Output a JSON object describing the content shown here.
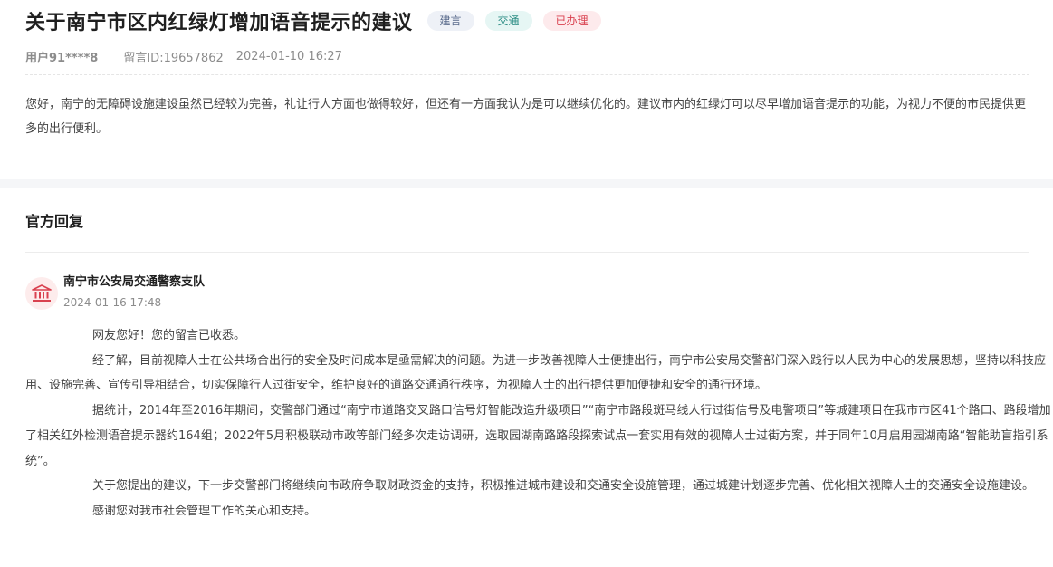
{
  "header": {
    "title": "关于南宁市区内红绿灯增加语音提示的建议",
    "tags": [
      {
        "label": "建言"
      },
      {
        "label": "交通"
      },
      {
        "label": "已办理"
      }
    ],
    "user": "用户91****8",
    "message_id": "留言ID:19657862",
    "time": "2024-01-10 16:27"
  },
  "message": {
    "text": "您好，南宁的无障碍设施建设虽然已经较为完善，礼让行人方面也做得较好，但还有一方面我认为是可以继续优化的。建议市内的红绿灯可以尽早增加语音提示的功能，为视力不便的市民提供更多的出行便利。"
  },
  "reply": {
    "heading": "官方回复",
    "org_icon": "government-building-icon",
    "org_name": "南宁市公安局交通警察支队",
    "time": "2024-01-16 17:48",
    "paragraphs": [
      "网友您好！您的留言已收悉。",
      "经了解，目前视障人士在公共场合出行的安全及时间成本是亟需解决的问题。为进一步改善视障人士便捷出行，南宁市公安局交警部门深入践行以人民为中心的发展思想，坚持以科技应用、设施完善、宣传引导相结合，切实保障行人过街安全，维护良好的道路交通通行秩序，为视障人士的出行提供更加便捷和安全的通行环境。",
      "据统计，2014年至2016年期间，交警部门通过“南宁市道路交叉路口信号灯智能改造升级项目”“南宁市路段斑马线人行过街信号及电警项目”等城建项目在我市市区41个路口、路段增加了相关红外检测语音提示器约164组；2022年5月积极联动市政等部门经多次走访调研，选取园湖南路路段探索试点一套实用有效的视障人士过街方案，并于同年10月启用园湖南路“智能助盲指引系统”。",
      "关于您提出的建议，下一步交警部门将继续向市政府争取财政资金的支持，积极推进城市建设和交通安全设施管理，通过城建计划逐步完善、优化相关视障人士的交通安全设施建设。",
      "感谢您对我市社会管理工作的关心和支持。"
    ]
  },
  "colors": {
    "tag_suggest_bg": "#eef1f7",
    "tag_traffic_bg": "#e6f6f4",
    "tag_done_bg": "#fdeaec",
    "tag_done_text": "#d9414f",
    "avatar_icon": "#d9414f"
  }
}
